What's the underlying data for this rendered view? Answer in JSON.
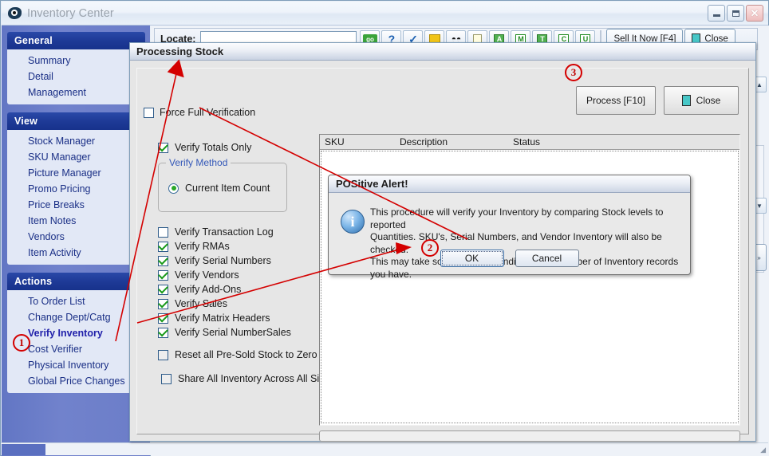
{
  "window": {
    "title": "Inventory Center",
    "icon": "app-swoosh-icon",
    "minimize": "–",
    "maximize": "□",
    "close": "✕"
  },
  "sidebar": {
    "panels": [
      {
        "title": "General",
        "items": [
          {
            "label": "Summary"
          },
          {
            "label": "Detail"
          },
          {
            "label": "Management"
          }
        ]
      },
      {
        "title": "View",
        "items": [
          {
            "label": "Stock Manager"
          },
          {
            "label": "SKU Manager"
          },
          {
            "label": "Picture Manager"
          },
          {
            "label": "Promo Pricing"
          },
          {
            "label": "Price Breaks"
          },
          {
            "label": "Item Notes"
          },
          {
            "label": "Vendors"
          },
          {
            "label": "Item Activity"
          }
        ]
      },
      {
        "title": "Actions",
        "items": [
          {
            "label": "To Order List"
          },
          {
            "label": "Change Dept/Catg"
          },
          {
            "label": "Verify Inventory",
            "active": true
          },
          {
            "label": "Cost Verifier"
          },
          {
            "label": "Physical Inventory"
          },
          {
            "label": "Global Price Changes"
          }
        ]
      }
    ]
  },
  "toolbar": {
    "locate_label": "Locate:",
    "locate_value": "",
    "locate_placeholder": "",
    "icons": [
      {
        "name": "go-icon",
        "glyph": "go"
      },
      {
        "name": "refresh-icon",
        "glyph": "?"
      },
      {
        "name": "edit-pen-icon",
        "glyph": "/"
      },
      {
        "name": "note-icon",
        "glyph": ""
      },
      {
        "name": "binoculars-icon",
        "glyph": "▲▲"
      },
      {
        "name": "document-icon",
        "glyph": ""
      },
      {
        "name": "a-icon",
        "glyph": "A"
      },
      {
        "name": "m-icon",
        "glyph": "M"
      },
      {
        "name": "t-icon",
        "glyph": "T"
      },
      {
        "name": "c-icon",
        "glyph": "C"
      },
      {
        "name": "u-icon",
        "glyph": "U"
      }
    ],
    "sell_button": "Sell It Now [F4]",
    "close_button": "Close"
  },
  "dialog": {
    "title": "Processing Stock",
    "process_button": "Process [F10]",
    "close_button": "Close",
    "force_full_verification": {
      "label": "Force Full Verification",
      "checked": false
    },
    "verify_totals_only": {
      "label": "Verify Totals Only",
      "checked": true
    },
    "verify_method": {
      "legend": "Verify Method",
      "options": [
        {
          "label": "Current Item Count",
          "selected": true
        }
      ]
    },
    "options": [
      {
        "label": "Verify Transaction Log",
        "checked": false
      },
      {
        "label": "Verify RMAs",
        "checked": true
      },
      {
        "label": "Verify Serial Numbers",
        "checked": true
      },
      {
        "label": "Verify Vendors",
        "checked": true
      },
      {
        "label": "Verify Add-Ons",
        "checked": true
      },
      {
        "label": "Verify Sales",
        "checked": true
      },
      {
        "label": "Verify Matrix Headers",
        "checked": true
      },
      {
        "label": "Verify Serial NumberSales",
        "checked": true
      }
    ],
    "reset_presold": {
      "label": "Reset all Pre-Sold Stock to Zero",
      "checked": false
    },
    "share_inventory": {
      "label": "Share All Inventory Across All Sites",
      "checked": false
    },
    "list": {
      "columns": [
        "SKU",
        "Description",
        "Status"
      ],
      "rows": []
    }
  },
  "alert": {
    "title": "POSitive Alert!",
    "icon": "info-icon",
    "icon_glyph": "i",
    "message": "This procedure will verify your Inventory by comparing Stock levels to reported\nQuantities.  SKU's, Serial Numbers, and Vendor Inventory will also be checked.\n This may take some time, depending on the number of Inventory records you have.",
    "ok_button": "OK",
    "cancel_button": "Cancel"
  },
  "annotations": {
    "color": "#d40000",
    "markers": [
      {
        "id": "1",
        "target": "Verify Inventory sidebar action"
      },
      {
        "id": "2",
        "target": "OK button in POSitive Alert"
      },
      {
        "id": "3",
        "target": "Process [F10] button"
      }
    ]
  }
}
